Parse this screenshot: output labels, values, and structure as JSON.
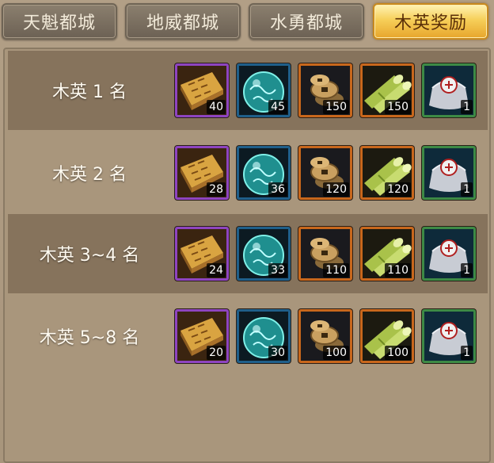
{
  "tabs": [
    {
      "label": "天魁都城",
      "active": false
    },
    {
      "label": "地威都城",
      "active": false
    },
    {
      "label": "水勇都城",
      "active": false
    },
    {
      "label": "木英奖励",
      "active": true
    }
  ],
  "items": [
    {
      "icon": "gold-tablet-icon",
      "quality": "purple"
    },
    {
      "icon": "jade-orb-icon",
      "quality": "blue"
    },
    {
      "icon": "copper-coins-icon",
      "quality": "orange"
    },
    {
      "icon": "bamboo-icon",
      "quality": "orange"
    },
    {
      "icon": "silver-sack-icon",
      "quality": "green"
    }
  ],
  "rows": [
    {
      "rank": "木英 1 名",
      "counts": [
        "40",
        "45",
        "150",
        "150",
        "1"
      ]
    },
    {
      "rank": "木英 2 名",
      "counts": [
        "28",
        "36",
        "120",
        "120",
        "1"
      ]
    },
    {
      "rank": "木英 3~4 名",
      "counts": [
        "24",
        "33",
        "110",
        "110",
        "1"
      ]
    },
    {
      "rank": "木英 5~8 名",
      "counts": [
        "20",
        "30",
        "100",
        "100",
        "1"
      ]
    }
  ],
  "colors": {
    "active_tab": "#f6cf59",
    "purple": "#8e44c0",
    "orange": "#c8671c",
    "green": "#3d8a45",
    "blue": "#1f5f8a"
  }
}
